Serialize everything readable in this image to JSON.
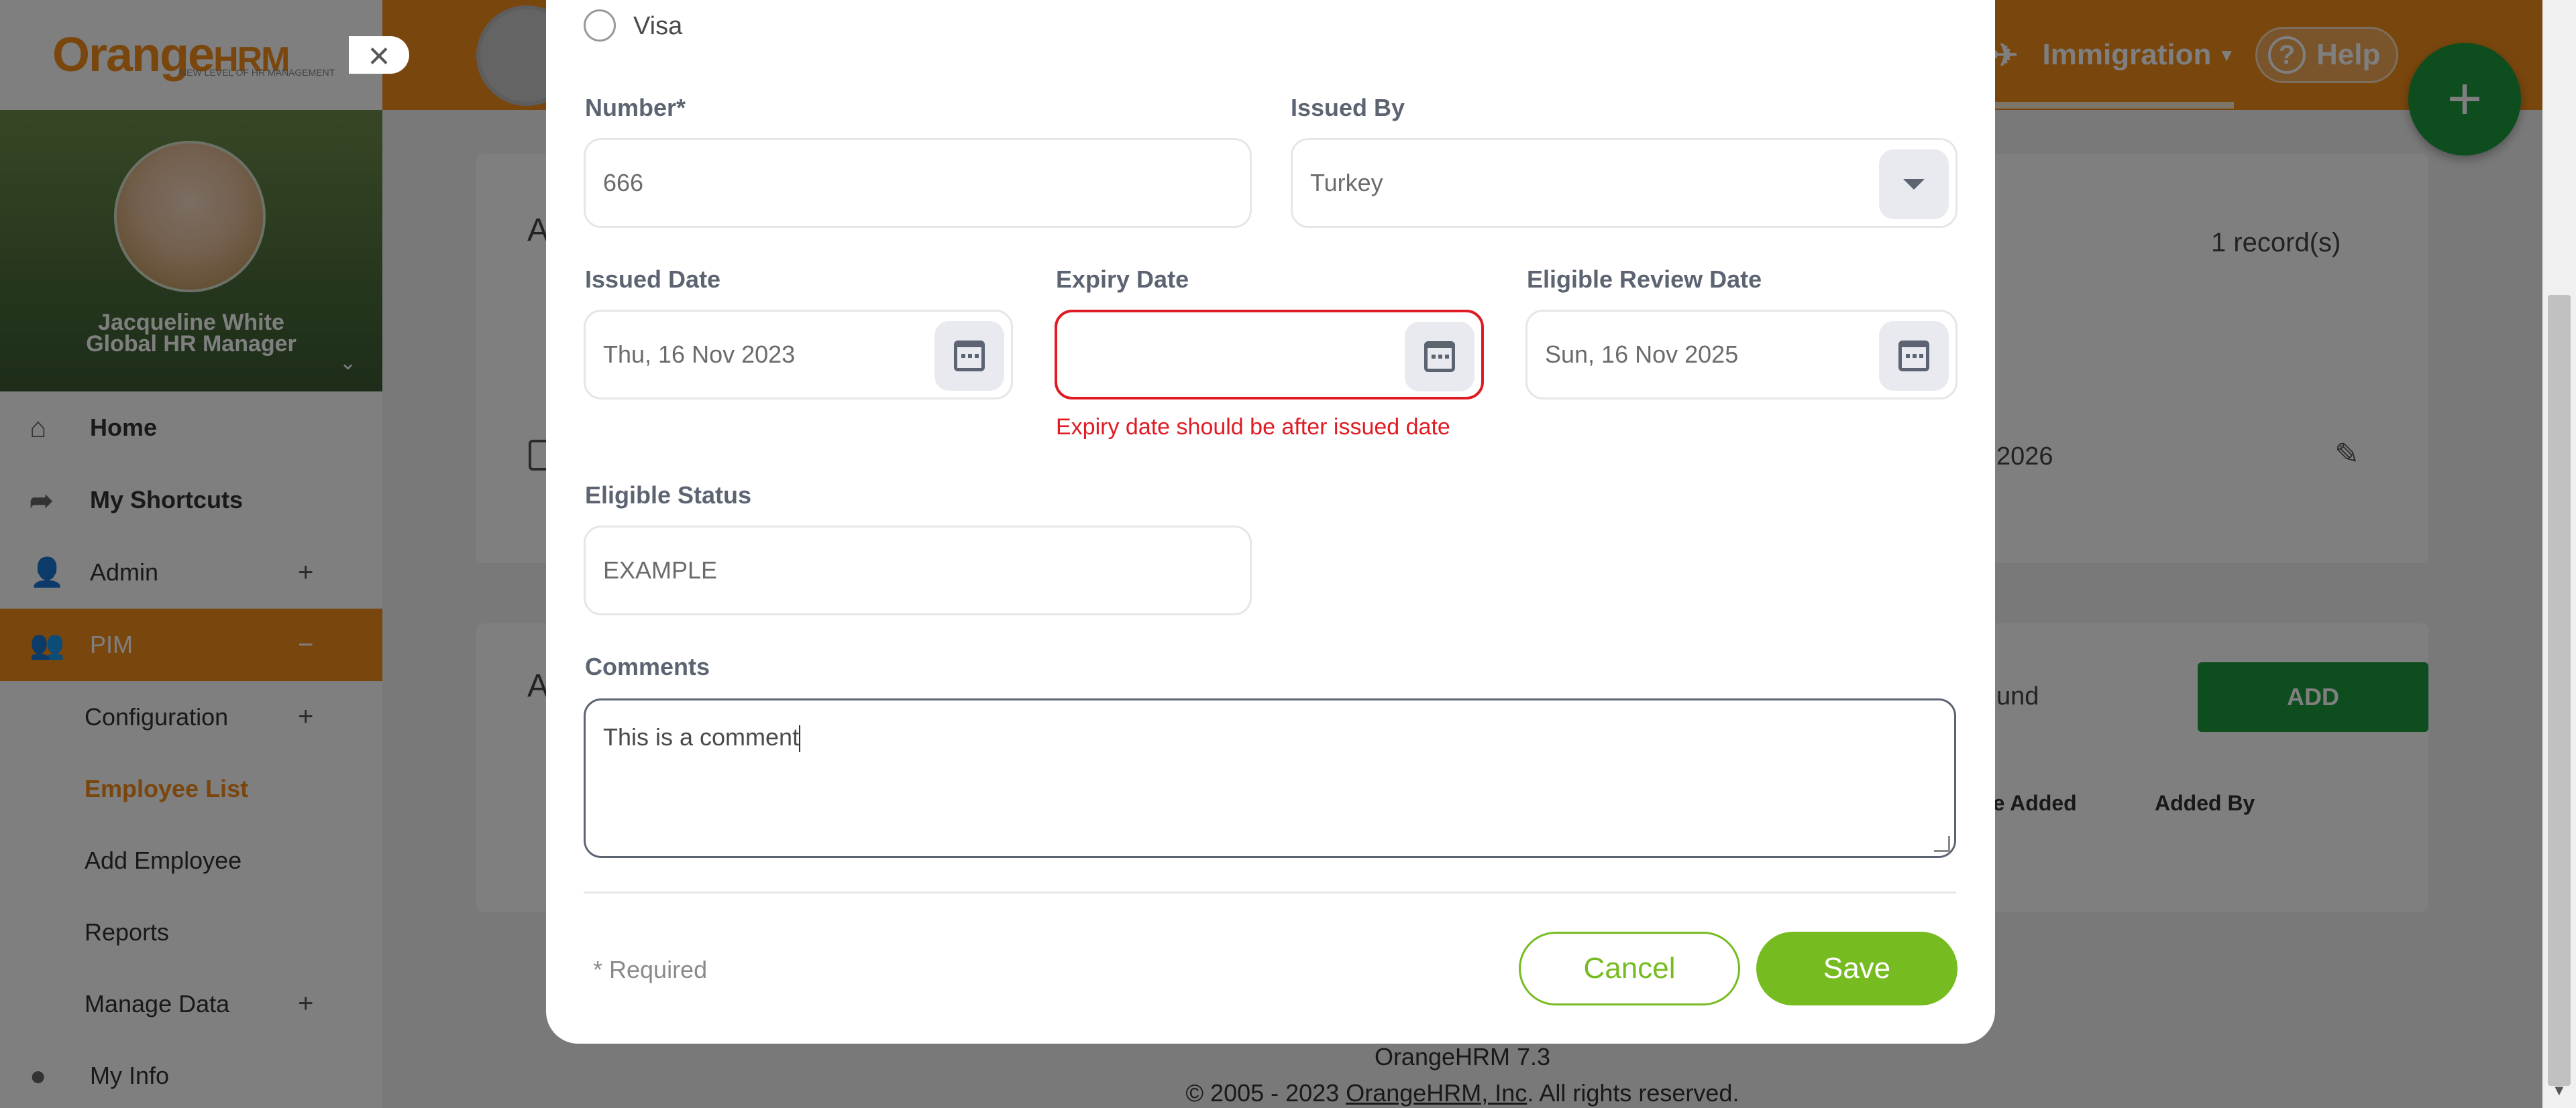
{
  "app": {
    "logo_main": "Orange",
    "logo_hrm": "HRM",
    "logo_tagline": "NEW LEVEL OF HR MANAGEMENT",
    "nav_current": "Immigration",
    "help_label": "Help"
  },
  "profile": {
    "name": "Jacqueline White",
    "role": "Global HR Manager"
  },
  "sidebar": {
    "items": [
      {
        "label": "Home"
      },
      {
        "label": "My Shortcuts"
      },
      {
        "label": "Admin",
        "toggle": "+"
      },
      {
        "label": "PIM",
        "toggle": "−"
      },
      {
        "label": "Configuration",
        "toggle": "+"
      },
      {
        "label": "Employee List"
      },
      {
        "label": "Add Employee"
      },
      {
        "label": "Reports"
      },
      {
        "label": "Manage Data",
        "toggle": "+"
      },
      {
        "label": "My Info"
      }
    ]
  },
  "background": {
    "heading_a": "A",
    "records": "1 record(s)",
    "row_date": "2026",
    "section2_a": "A",
    "not_found_fragment": "und",
    "add_button": "ADD",
    "col_date_added": "te Added",
    "col_added_by": "Added By",
    "footer_version": "OrangeHRM 7.3",
    "footer_copy_prefix": "© 2005 - 2023 ",
    "footer_copy_link": "OrangeHRM, Inc",
    "footer_copy_suffix": ". All rights reserved."
  },
  "modal": {
    "document_type": "Visa",
    "number_label": "Number*",
    "number_value": "666",
    "issued_by_label": "Issued By",
    "issued_by_value": "Turkey",
    "issued_date_label": "Issued Date",
    "issued_date_value": "Thu, 16 Nov 2023",
    "expiry_date_label": "Expiry Date",
    "expiry_date_value": "",
    "expiry_error": "Expiry date should be after issued date",
    "review_date_label": "Eligible Review Date",
    "review_date_value": "Sun, 16 Nov 2025",
    "eligible_status_label": "Eligible Status",
    "eligible_status_value": "EXAMPLE",
    "comments_label": "Comments",
    "comments_value": "This is a comment",
    "required_note": "* Required",
    "cancel_label": "Cancel",
    "save_label": "Save"
  },
  "colors": {
    "brand_orange": "#f28c1c",
    "action_green": "#76bc21",
    "error_red": "#e01b24",
    "add_green": "#1a9a3c"
  },
  "icons": [
    "close-icon",
    "home-icon",
    "shortcut-icon",
    "admin-icon",
    "pim-icon",
    "myinfo-icon",
    "plane-icon",
    "help-icon",
    "plus-icon",
    "calendar-icon",
    "dropdown-caret-icon",
    "edit-icon"
  ]
}
